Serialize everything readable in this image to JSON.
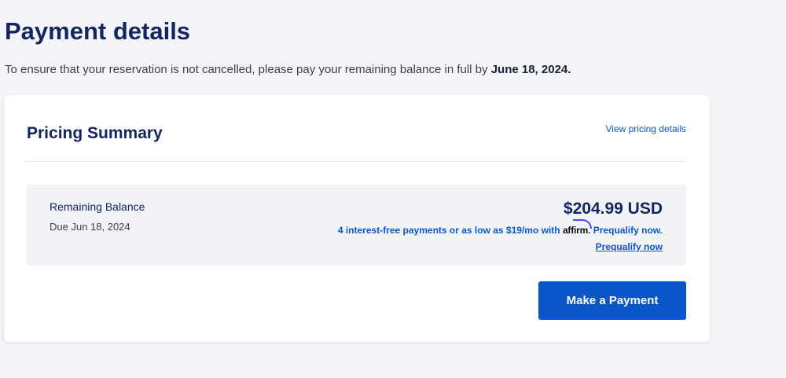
{
  "page": {
    "title": "Payment details",
    "notice_text": "To ensure that your reservation is not cancelled, please pay your remaining balance in full by ",
    "notice_date": "June 18, 2024."
  },
  "summary": {
    "title": "Pricing Summary",
    "view_details_link": "View pricing details",
    "balance_label": "Remaining Balance",
    "due_text": "Due Jun 18, 2024",
    "amount": "$204.99 USD",
    "affirm_prefix": "4 interest-free payments or as low as $19/mo with ",
    "affirm_brand": "affirm",
    "affirm_suffix": ". Prequalify now.",
    "prequalify_link": "Prequalify now",
    "pay_button": "Make a Payment"
  },
  "colors": {
    "brand_blue": "#0a56c9",
    "navy": "#132660",
    "affirm_arc": "#4a4af4"
  }
}
